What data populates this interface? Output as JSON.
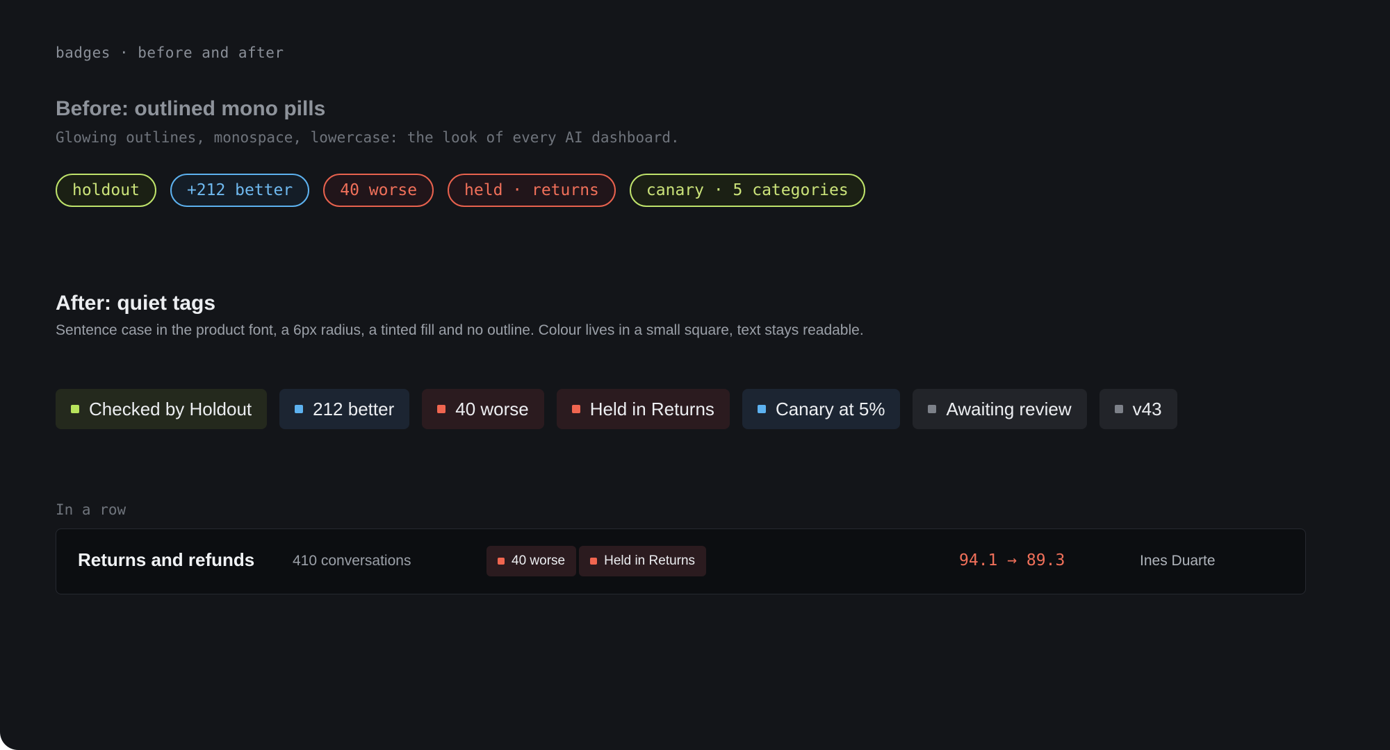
{
  "eyebrow": "badges · before and after",
  "before": {
    "title": "Before: outlined mono pills",
    "subtitle": "Glowing outlines, monospace, lowercase: the look of every AI dashboard.",
    "pills": [
      {
        "label": "holdout",
        "color": "#bfe36b"
      },
      {
        "label": "+212 better",
        "color": "#5db2f0"
      },
      {
        "label": "40 worse",
        "color": "#e8624e"
      },
      {
        "label": "held · returns",
        "color": "#e8624e"
      },
      {
        "label": "canary · 5 categories",
        "color": "#bfe36b"
      }
    ]
  },
  "after": {
    "title": "After: quiet tags",
    "subtitle": "Sentence case in the product font, a 6px radius, a tinted fill and no outline. Colour lives in a small square, text stays readable.",
    "tags": [
      {
        "label": "Checked by Holdout",
        "dot_color": "#b7e35c"
      },
      {
        "label": "212 better",
        "dot_color": "#5db2f0"
      },
      {
        "label": "40 worse",
        "dot_color": "#f06650"
      },
      {
        "label": "Held in Returns",
        "dot_color": "#f06650"
      },
      {
        "label": "Canary at 5%",
        "dot_color": "#5db2f0"
      },
      {
        "label": "Awaiting review",
        "dot_color": "#7d8189"
      },
      {
        "label": "v43",
        "dot_color": "#7d8189"
      }
    ]
  },
  "row_example": {
    "label": "In a row",
    "name": "Returns and refunds",
    "count": "410 conversations",
    "tags": [
      {
        "label": "40 worse",
        "dot_color": "#f06650"
      },
      {
        "label": "Held in Returns",
        "dot_color": "#f06650"
      }
    ],
    "metric": "94.1 → 89.3",
    "owner": "Ines Duarte"
  }
}
